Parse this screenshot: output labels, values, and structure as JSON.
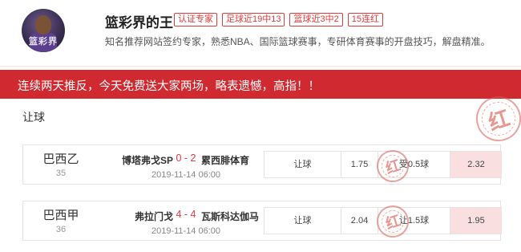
{
  "profile": {
    "avatar_watermark": "篮彩界",
    "name": "篮彩界的王",
    "badges": [
      "认证专家",
      "足球近19中13",
      "篮球近3中2",
      "15连红"
    ],
    "bio": "知名推荐网站签约专家，熟悉NBA、国际篮球赛事，专研体育赛事的开盘技巧，解盘精准。"
  },
  "banner": {
    "text": "连续两天推反，今天免费送大家两场，略表遗憾，高指！！"
  },
  "section": {
    "title": "让球"
  },
  "stamp": {
    "text": "红"
  },
  "matches": [
    {
      "league": "巴西乙",
      "league_no": "35",
      "home": "博塔弗戈SP",
      "score": "0 - 2",
      "away": "累西腓体育",
      "time": "2019-11-14 06:00",
      "bet_type": "让球",
      "home_odds": "1.75",
      "line": "受0.5球",
      "pick_odds": "2.32"
    },
    {
      "league": "巴西甲",
      "league_no": "36",
      "home": "弗拉门戈",
      "score": "4 - 4",
      "away": "瓦斯科达伽马",
      "time": "2019-11-14 06:00",
      "bet_type": "让球",
      "home_odds": "2.04",
      "line": "让1.5球",
      "pick_odds": "1.95"
    }
  ],
  "colors": {
    "accent": "#d0292f",
    "badge": "#e03a3a",
    "pick_bg": "#f9dfe0"
  }
}
